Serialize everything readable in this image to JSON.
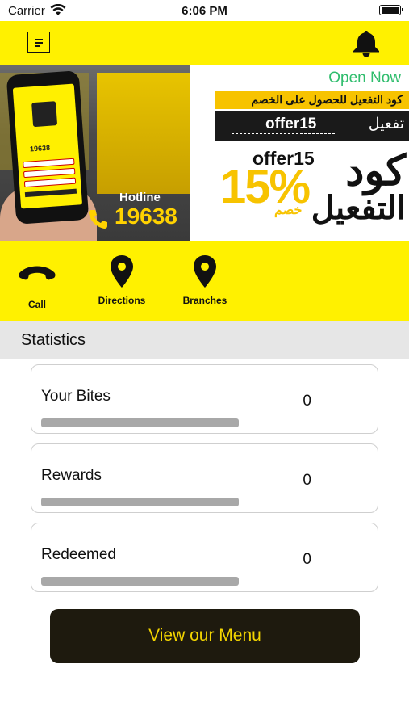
{
  "status_bar": {
    "carrier": "Carrier",
    "time": "6:06 PM"
  },
  "header": {
    "menu_icon": "menu-icon",
    "notification_icon": "bell-icon"
  },
  "banner": {
    "hotline_label": "Hotline",
    "hotline_number": "19638",
    "phone_number": "19638",
    "open_status": "Open Now",
    "promo_headline": "كود التفعيل للحصول على الخصم",
    "promo_code": "offer15",
    "promo_activate": "تفعيل",
    "offer_label": "offer15",
    "discount": "15%",
    "discount_word": "خصم",
    "code_word": "كود",
    "activation_word": "التفعيل"
  },
  "actions": [
    {
      "label": "Call",
      "icon": "phone-icon"
    },
    {
      "label": "Directions",
      "icon": "map-pin-icon"
    },
    {
      "label": "Branches",
      "icon": "map-pin-icon"
    }
  ],
  "statistics": {
    "title": "Statistics",
    "items": [
      {
        "label": "Your Bites",
        "value": "0",
        "progress": 0
      },
      {
        "label": "Rewards",
        "value": "0",
        "progress": 0
      },
      {
        "label": "Redeemed",
        "value": "0",
        "progress": 0
      }
    ]
  },
  "cta": {
    "label": "View our Menu"
  },
  "colors": {
    "brand_yellow": "#fff100",
    "open_green": "#2fbd6d",
    "cta_bg": "#1e1a0e",
    "cta_text": "#f2d400"
  }
}
